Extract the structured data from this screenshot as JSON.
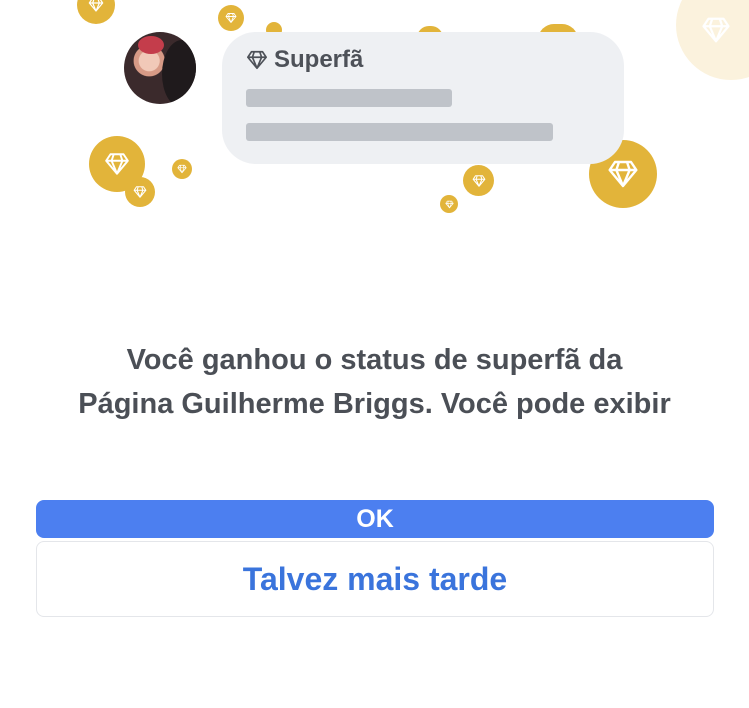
{
  "badge_card": {
    "title": "Superfã",
    "icon": "diamond-icon"
  },
  "message": {
    "line1": "Você ganhou o status de superfã da",
    "line2": "Página Guilherme Briggs. Você pode exibir"
  },
  "buttons": {
    "ok_label": "OK",
    "later_label": "Talvez mais tarde"
  },
  "colors": {
    "gold": "#e2b43a",
    "primary": "#4c7ff0",
    "link": "#3a74dc",
    "text": "#4b4f56"
  }
}
